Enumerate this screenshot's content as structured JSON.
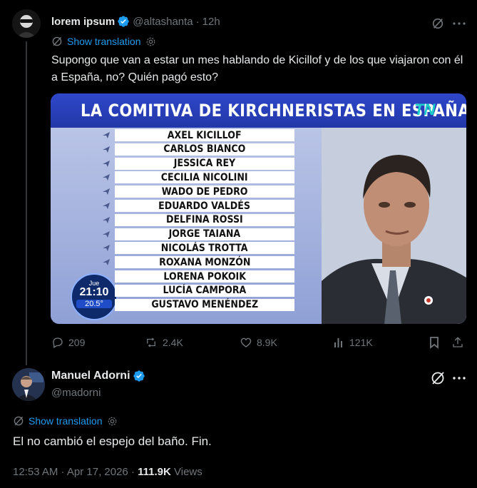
{
  "tweet1": {
    "author_name": "lorem ipsum",
    "handle": "@altashanta",
    "separator": "·",
    "time_ago": "12h",
    "show_translation": "Show translation",
    "text": "Supongo que van a estar un mes hablando de Kicillof y de los que viajaron con él a España, no? Quién pagó esto?",
    "media": {
      "banner_title": "LA COMITIVA DE KIRCHNERISTAS EN ESPAÑA",
      "logo": "TN",
      "names": [
        "AXEL KICILLOF",
        "CARLOS BIANCO",
        "JESSICA REY",
        "CECILIA NICOLINI",
        "WADO DE PEDRO",
        "EDUARDO VALDÉS",
        "DELFINA ROSSI",
        "JORGE TAIANA",
        "NICOLÁS TROTTA",
        "ROXANA MONZÓN",
        "LORENA POKOIK",
        "LUCÍA CAMPORA",
        "GUSTAVO MENÉNDEZ"
      ],
      "clock_day": "Jue",
      "clock_time": "21:10",
      "clock_temp": "20.5°"
    },
    "actions": {
      "replies": "209",
      "reposts": "2.4K",
      "likes": "8.9K",
      "views": "121K"
    }
  },
  "tweet2": {
    "author_name": "Manuel Adorni",
    "handle": "@madorni",
    "show_translation": "Show translation",
    "text": "El no cambió el espejo del baño. Fin.",
    "timestamp": "12:53 AM · Apr 17, 2026 ·",
    "views_count": "111.9K",
    "views_label": "Views"
  },
  "colors": {
    "background": "#000000",
    "text": "#e7e9ea",
    "muted": "#71767b",
    "link": "#1d9bf0",
    "verified": "#1d9bf0"
  }
}
